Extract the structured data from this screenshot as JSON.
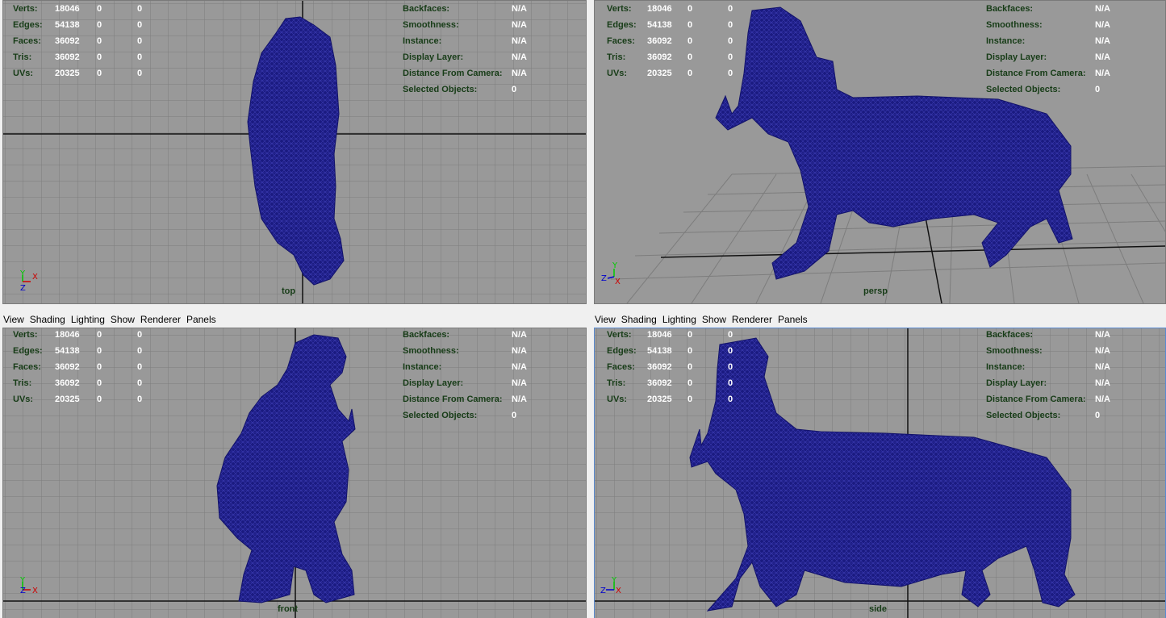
{
  "menu": [
    "View",
    "Shading",
    "Lighting",
    "Show",
    "Renderer",
    "Panels"
  ],
  "stats": {
    "rows": [
      {
        "label": "Verts:",
        "v1": "18046",
        "v2": "0",
        "v3": "0"
      },
      {
        "label": "Edges:",
        "v1": "54138",
        "v2": "0",
        "v3": "0"
      },
      {
        "label": "Faces:",
        "v1": "36092",
        "v2": "0",
        "v3": "0"
      },
      {
        "label": "Tris:",
        "v1": "36092",
        "v2": "0",
        "v3": "0"
      },
      {
        "label": "UVs:",
        "v1": "20325",
        "v2": "0",
        "v3": "0"
      }
    ],
    "info": [
      {
        "label": "Backfaces:",
        "value": "N/A"
      },
      {
        "label": "Smoothness:",
        "value": "N/A"
      },
      {
        "label": "Instance:",
        "value": "N/A"
      },
      {
        "label": "Display Layer:",
        "value": "N/A"
      },
      {
        "label": "Distance From Camera:",
        "value": "N/A"
      }
    ],
    "selected_label": "Selected Objects:",
    "selected_value": "0"
  },
  "viewports": {
    "top": {
      "camera": "top",
      "axis_a": "Y",
      "axis_b": "X",
      "axis_c": "Z"
    },
    "persp": {
      "camera": "persp",
      "axis_a": "Y",
      "axis_b": "X",
      "axis_c": "Z"
    },
    "front": {
      "camera": "front",
      "axis_a": "Y",
      "axis_b": "X",
      "axis_c": "Z"
    },
    "side": {
      "camera": "side",
      "axis_a": "Y",
      "axis_b": "X",
      "axis_c": "Z"
    }
  },
  "colors": {
    "viewport_bg": "#999999",
    "grid_line": "#7d7d7d",
    "axis_line": "#111111",
    "mesh": "#1a1a80",
    "hud_text": "#173c17",
    "hud_value": "#ffffff"
  }
}
